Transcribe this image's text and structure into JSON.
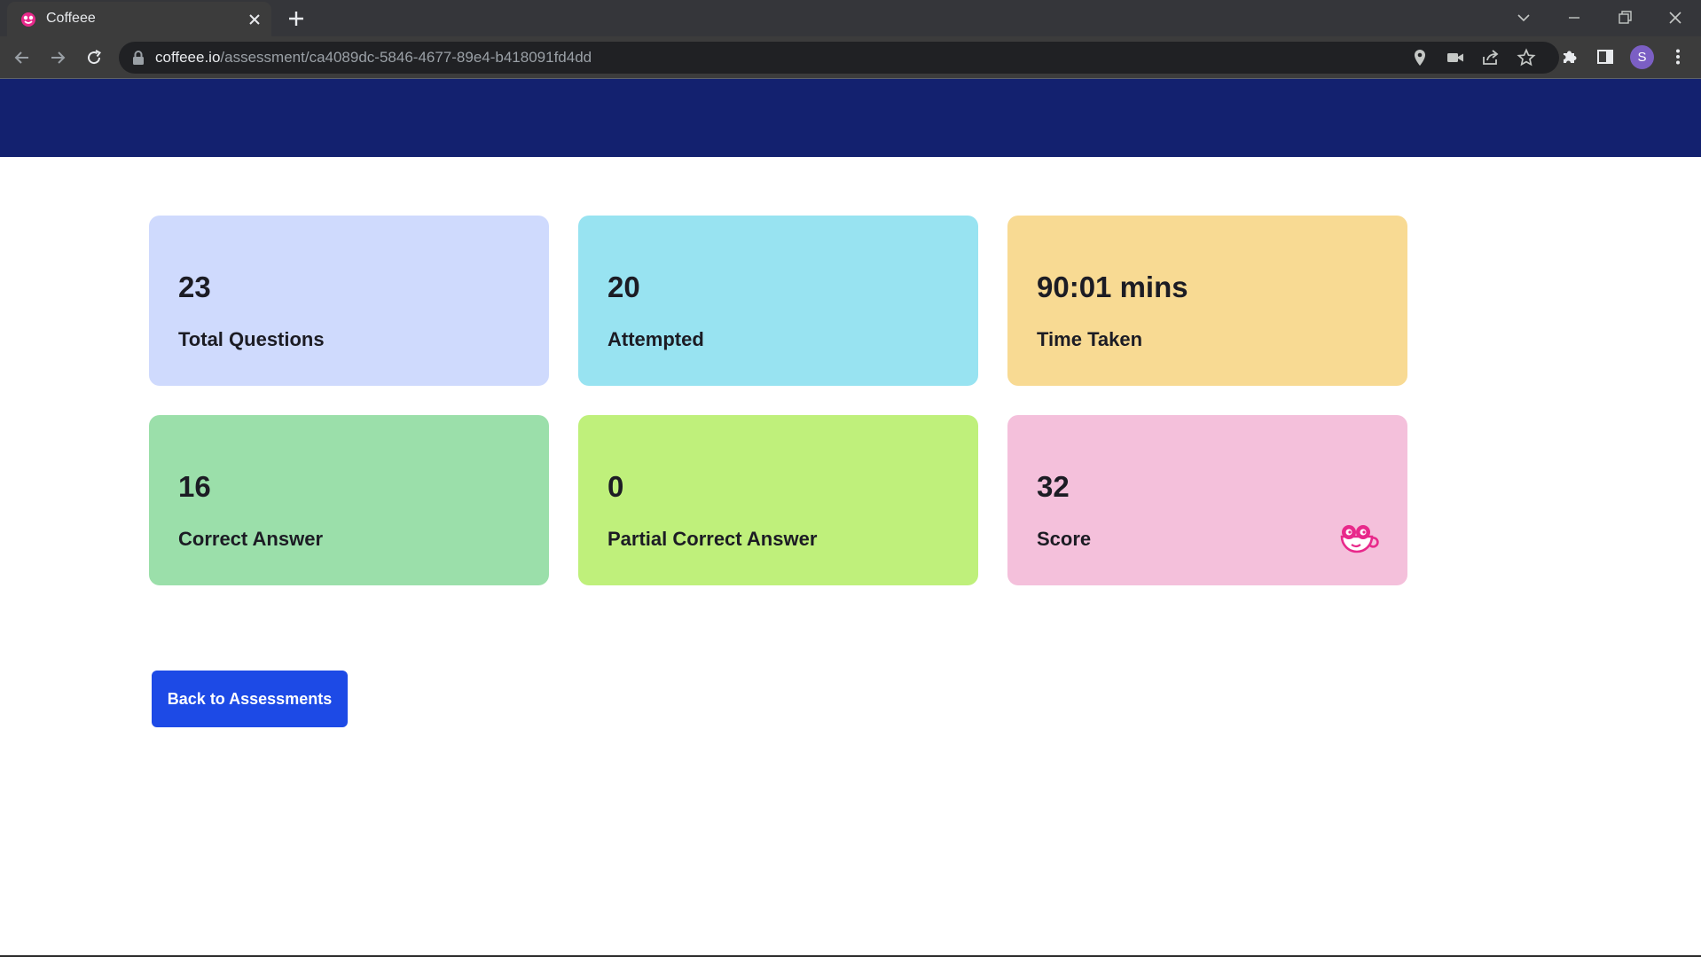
{
  "browser": {
    "tab_title": "Coffeee",
    "url_host": "coffeee.io",
    "url_path": "/assessment/ca4089dc-5846-4677-89e4-b418091fd4dd",
    "profile_initial": "S"
  },
  "stats": [
    {
      "value": "23",
      "label": "Total Questions",
      "color": "#cfdafd"
    },
    {
      "value": "20",
      "label": "Attempted",
      "color": "#98e3f1"
    },
    {
      "value": "90:01 mins",
      "label": "Time Taken",
      "color": "#f8da93"
    },
    {
      "value": "16",
      "label": "Correct Answer",
      "color": "#9bdfaa"
    },
    {
      "value": "0",
      "label": "Partial Correct Answer",
      "color": "#bff07b"
    },
    {
      "value": "32",
      "label": "Score",
      "color": "#f4c0db",
      "icon": "coffee-mascot-icon"
    }
  ],
  "actions": {
    "back_label": "Back to Assessments"
  },
  "colors": {
    "header": "#13216f",
    "button": "#1d4ae6",
    "brand_pink": "#e8298b"
  }
}
